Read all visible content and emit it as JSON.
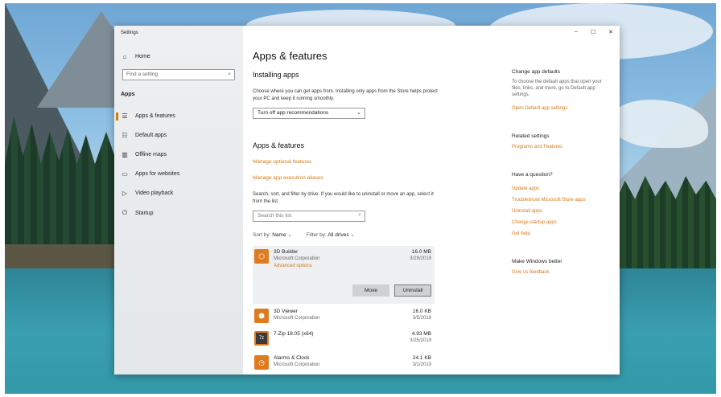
{
  "window": {
    "title": "Settings",
    "controls": [
      "–",
      "☐",
      "✕"
    ]
  },
  "sidebar": {
    "home": "Home",
    "search_placeholder": "Find a setting",
    "section": "Apps",
    "items": [
      {
        "label": "Apps & features",
        "icon": "list-icon"
      },
      {
        "label": "Default apps",
        "icon": "default-apps-icon"
      },
      {
        "label": "Offline maps",
        "icon": "map-icon"
      },
      {
        "label": "Apps for websites",
        "icon": "websites-icon"
      },
      {
        "label": "Video playback",
        "icon": "video-icon"
      },
      {
        "label": "Startup",
        "icon": "startup-icon"
      }
    ]
  },
  "main": {
    "title": "Apps & features",
    "installing_heading": "Installing apps",
    "installing_text": "Choose where you can get apps from. Installing only apps from the Store helps protect your PC and keep it running smoothly.",
    "dropdown_value": "Turn off app recommendations",
    "apps_heading": "Apps & features",
    "link_optional": "Manage optional features",
    "link_aliases": "Manage app execution aliases",
    "search_text": "Search, sort, and filter by drive. If you would like to uninstall or move an app, select it from the list.",
    "list_search_placeholder": "Search this list",
    "sort_label": "Sort by:",
    "sort_value": "Name",
    "filter_label": "Filter by:",
    "filter_value": "All drives",
    "apps": [
      {
        "name": "3D Builder",
        "publisher": "Microsoft Corporation",
        "size": "16.0 MB",
        "date": "3/29/2019",
        "advanced": "Advanced options",
        "color": "#e07a1f"
      },
      {
        "name": "3D Viewer",
        "publisher": "Microsoft Corporation",
        "size": "16.0 KB",
        "date": "3/5/2019",
        "color": "#e07a1f"
      },
      {
        "name": "7-Zip 18.05 (x64)",
        "publisher": "",
        "size": "4.93 MB",
        "date": "3/25/2019",
        "color": "#4a4a4a"
      },
      {
        "name": "Alarms & Clock",
        "publisher": "Microsoft Corporation",
        "size": "24.1 KB",
        "date": "3/1/2019",
        "color": "#e07a1f"
      }
    ],
    "move_button": "Move",
    "uninstall_button": "Uninstall"
  },
  "right": {
    "defaults_heading": "Change app defaults",
    "defaults_text": "To choose the default apps that open your files, links, and more, go to Default app settings.",
    "defaults_link": "Open Default app settings",
    "related_heading": "Related settings",
    "related_link": "Programs and Features",
    "question_heading": "Have a question?",
    "question_links": [
      "Update apps",
      "Troubleshoot Microsoft Store apps",
      "Uninstall apps",
      "Change startup apps",
      "Get help"
    ],
    "better_heading": "Make Windows better",
    "better_link": "Give us feedback"
  },
  "colors": {
    "accent": "#d37a19"
  }
}
